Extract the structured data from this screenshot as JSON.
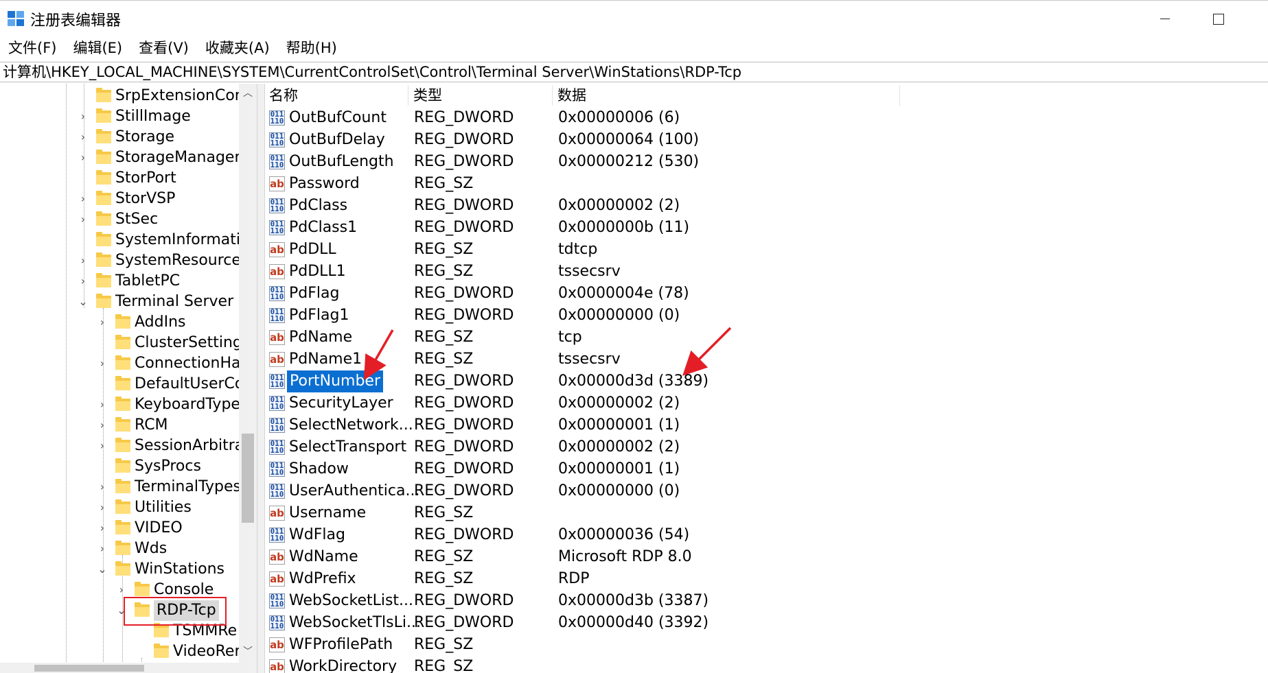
{
  "window": {
    "title": "注册表编辑器"
  },
  "menu": {
    "items": [
      "文件(F)",
      "编辑(E)",
      "查看(V)",
      "收藏夹(A)",
      "帮助(H)"
    ]
  },
  "address": {
    "path": "计算机\\HKEY_LOCAL_MACHINE\\SYSTEM\\CurrentControlSet\\Control\\Terminal Server\\WinStations\\RDP-Tcp"
  },
  "tree": {
    "items": [
      {
        "label": "SrpExtensionConf",
        "expander": ""
      },
      {
        "label": "StillImage",
        "expander": "›"
      },
      {
        "label": "Storage",
        "expander": "›"
      },
      {
        "label": "StorageManagem",
        "expander": "›"
      },
      {
        "label": "StorPort",
        "expander": ""
      },
      {
        "label": "StorVSP",
        "expander": "›"
      },
      {
        "label": "StSec",
        "expander": "›"
      },
      {
        "label": "SystemInformatio",
        "expander": ""
      },
      {
        "label": "SystemResources",
        "expander": "›"
      },
      {
        "label": "TabletPC",
        "expander": "›"
      },
      {
        "label": "Terminal Server",
        "expander": "⌄"
      },
      {
        "label": "AddIns",
        "expander": "›"
      },
      {
        "label": "ClusterSettings",
        "expander": ""
      },
      {
        "label": "ConnectionHar",
        "expander": "›"
      },
      {
        "label": "DefaultUserCo",
        "expander": ""
      },
      {
        "label": "KeyboardType",
        "expander": "›"
      },
      {
        "label": "RCM",
        "expander": "›"
      },
      {
        "label": "SessionArbitrat",
        "expander": "›"
      },
      {
        "label": "SysProcs",
        "expander": ""
      },
      {
        "label": "TerminalTypes",
        "expander": "›"
      },
      {
        "label": "Utilities",
        "expander": "›"
      },
      {
        "label": "VIDEO",
        "expander": "›"
      },
      {
        "label": "Wds",
        "expander": "›"
      },
      {
        "label": "WinStations",
        "expander": "⌄"
      },
      {
        "label": "Console",
        "expander": "›"
      },
      {
        "label": "RDP-Tcp",
        "expander": "⌄"
      },
      {
        "label": "TSMMRe",
        "expander": ""
      },
      {
        "label": "VideoRer",
        "expander": ""
      }
    ]
  },
  "list": {
    "headers": {
      "name": "名称",
      "type": "类型",
      "data": "数据"
    },
    "rows": [
      {
        "icon": "dword",
        "name": "OutBufCount",
        "type": "REG_DWORD",
        "data": "0x00000006 (6)"
      },
      {
        "icon": "dword",
        "name": "OutBufDelay",
        "type": "REG_DWORD",
        "data": "0x00000064 (100)"
      },
      {
        "icon": "dword",
        "name": "OutBufLength",
        "type": "REG_DWORD",
        "data": "0x00000212 (530)"
      },
      {
        "icon": "sz",
        "name": "Password",
        "type": "REG_SZ",
        "data": ""
      },
      {
        "icon": "dword",
        "name": "PdClass",
        "type": "REG_DWORD",
        "data": "0x00000002 (2)"
      },
      {
        "icon": "dword",
        "name": "PdClass1",
        "type": "REG_DWORD",
        "data": "0x0000000b (11)"
      },
      {
        "icon": "sz",
        "name": "PdDLL",
        "type": "REG_SZ",
        "data": "tdtcp"
      },
      {
        "icon": "sz",
        "name": "PdDLL1",
        "type": "REG_SZ",
        "data": "tssecsrv"
      },
      {
        "icon": "dword",
        "name": "PdFlag",
        "type": "REG_DWORD",
        "data": "0x0000004e (78)"
      },
      {
        "icon": "dword",
        "name": "PdFlag1",
        "type": "REG_DWORD",
        "data": "0x00000000 (0)"
      },
      {
        "icon": "sz",
        "name": "PdName",
        "type": "REG_SZ",
        "data": "tcp"
      },
      {
        "icon": "sz",
        "name": "PdName1",
        "type": "REG_SZ",
        "data": "tssecsrv"
      },
      {
        "icon": "dword",
        "name": "PortNumber",
        "type": "REG_DWORD",
        "data": "0x00000d3d (3389)",
        "selected": true
      },
      {
        "icon": "dword",
        "name": "SecurityLayer",
        "type": "REG_DWORD",
        "data": "0x00000002 (2)"
      },
      {
        "icon": "dword",
        "name": "SelectNetwork...",
        "type": "REG_DWORD",
        "data": "0x00000001 (1)"
      },
      {
        "icon": "dword",
        "name": "SelectTransport",
        "type": "REG_DWORD",
        "data": "0x00000002 (2)"
      },
      {
        "icon": "dword",
        "name": "Shadow",
        "type": "REG_DWORD",
        "data": "0x00000001 (1)"
      },
      {
        "icon": "dword",
        "name": "UserAuthentica...",
        "type": "REG_DWORD",
        "data": "0x00000000 (0)"
      },
      {
        "icon": "sz",
        "name": "Username",
        "type": "REG_SZ",
        "data": ""
      },
      {
        "icon": "dword",
        "name": "WdFlag",
        "type": "REG_DWORD",
        "data": "0x00000036 (54)"
      },
      {
        "icon": "sz",
        "name": "WdName",
        "type": "REG_SZ",
        "data": "Microsoft RDP 8.0"
      },
      {
        "icon": "sz",
        "name": "WdPrefix",
        "type": "REG_SZ",
        "data": "RDP"
      },
      {
        "icon": "dword",
        "name": "WebSocketList...",
        "type": "REG_DWORD",
        "data": "0x00000d3b (3387)"
      },
      {
        "icon": "dword",
        "name": "WebSocketTlsLi...",
        "type": "REG_DWORD",
        "data": "0x00000d40 (3392)"
      },
      {
        "icon": "sz",
        "name": "WFProfilePath",
        "type": "REG_SZ",
        "data": ""
      },
      {
        "icon": "sz",
        "name": "WorkDirectory",
        "type": "REG_SZ",
        "data": ""
      }
    ]
  },
  "icons": {
    "dword_glyph": "011\n110",
    "sz_glyph": "ab"
  },
  "colors": {
    "selection": "#0b6fd1",
    "annotation": "#e41e26",
    "folder": "#f7c948"
  }
}
